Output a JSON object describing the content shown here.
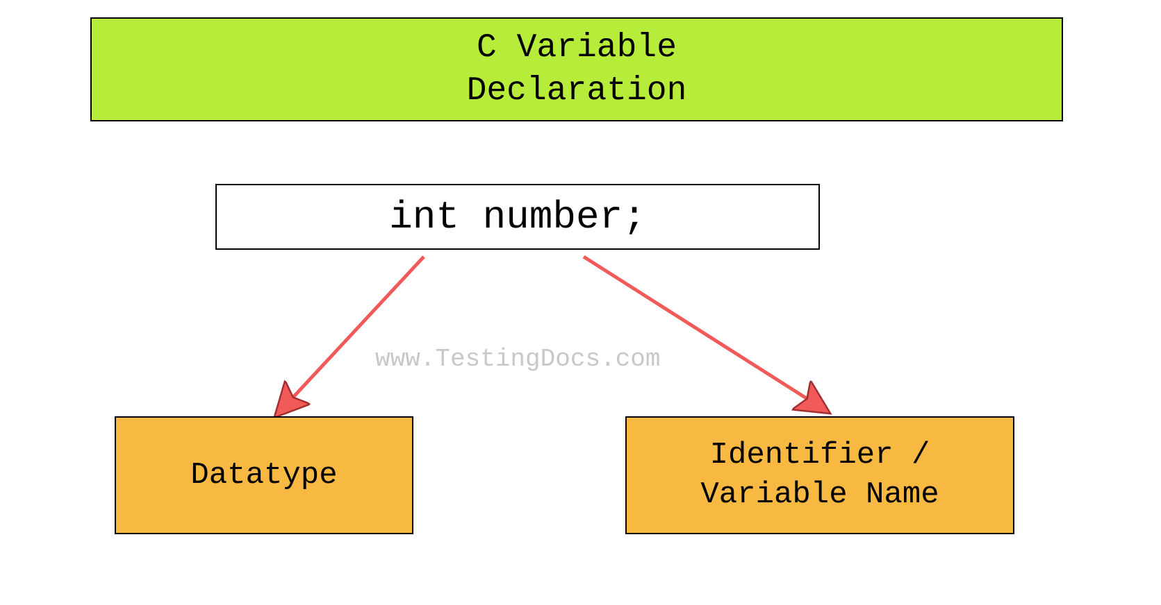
{
  "title": "C Variable\nDeclaration",
  "code": "int number;",
  "watermark": "www.TestingDocs.com",
  "datatype_label": "Datatype",
  "identifier_label": "Identifier /\nVariable Name"
}
